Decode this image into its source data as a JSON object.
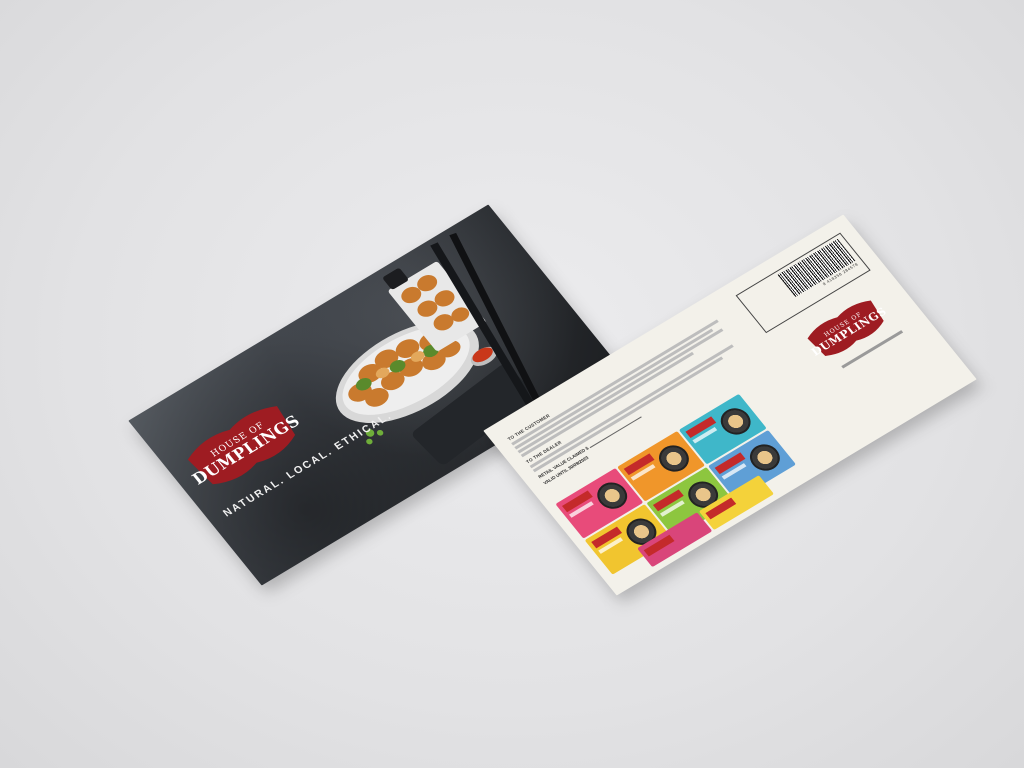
{
  "scene": {
    "background_color": "#e4e4e6",
    "brand_color": "#9e1c22"
  },
  "front_card": {
    "logo": {
      "top": "HOUSE OF",
      "main": "DUMPLINGS"
    },
    "tagline": "NATURAL. LOCAL. ETHICAL."
  },
  "back_card": {
    "logo": {
      "top": "HOUSE OF",
      "main": "DUMPLINGS"
    },
    "customer_heading": "TO THE CUSTOMER",
    "dealer_heading": "TO THE DEALER",
    "retail_value_label": "RETAIL VALUE CLAIMED $",
    "valid_until_label": "VALID UNTIL",
    "valid_until_value": "30/09/2023",
    "barcode_number": "9 418358 284578",
    "product_colors": [
      "#e84b7a",
      "#f0962a",
      "#3fb7c9",
      "#f1c52f",
      "#8dc63f",
      "#5f9fd6",
      "#d9457a",
      "#f4d23a"
    ]
  }
}
